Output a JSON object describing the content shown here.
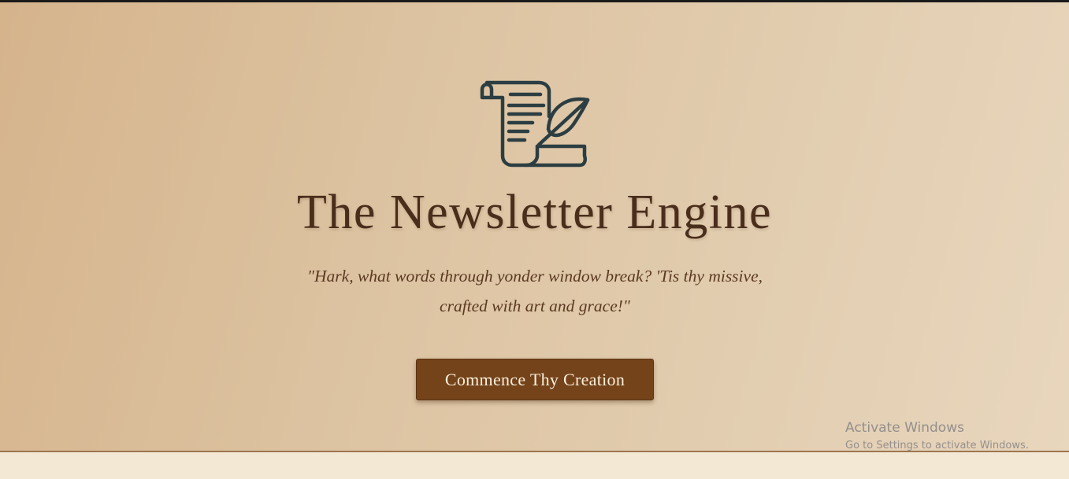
{
  "hero": {
    "icon": "scroll-quill-icon",
    "title": "The Newsletter Engine",
    "tagline": "\"Hark, what words through yonder window break? 'Tis thy missive, crafted with art and grace!\"",
    "cta_label": "Commence Thy Creation"
  },
  "watermark": {
    "title": "Activate Windows",
    "subtitle": "Go to Settings to activate Windows."
  },
  "colors": {
    "title": "#4a2e1c",
    "button": "#74431a",
    "button_text": "#fbf0dc",
    "icon_stroke": "#2c3e42"
  }
}
